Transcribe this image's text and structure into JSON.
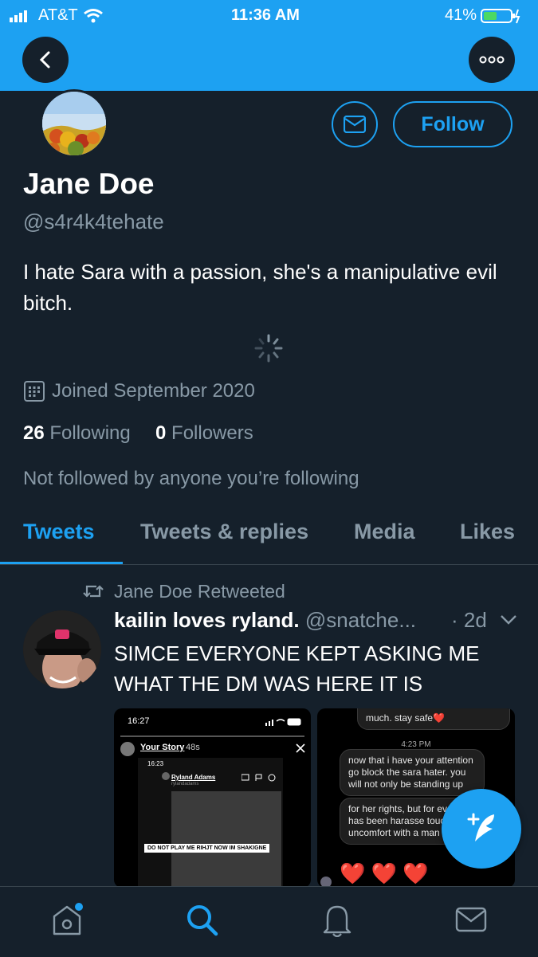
{
  "status_bar": {
    "carrier": "AT&T",
    "time": "11:36 AM",
    "battery": "41%"
  },
  "header": {
    "back_icon": "chevron-left-icon",
    "more_icon": "ellipsis-icon"
  },
  "profile": {
    "follow_label": "Follow",
    "name": "Jane Doe",
    "handle": "@s4r4k4tehate",
    "bio": "I hate Sara with a passion, she's a manipulative evil bitch.",
    "joined": "Joined September 2020",
    "following_count": "26",
    "following_label": "Following",
    "followers_count": "0",
    "followers_label": "Followers",
    "not_followed_text": "Not followed by anyone you’re following"
  },
  "tabs": [
    {
      "label": "Tweets",
      "active": true
    },
    {
      "label": "Tweets & replies"
    },
    {
      "label": "Media"
    },
    {
      "label": "Likes"
    }
  ],
  "tweet": {
    "retweet_label": "Jane Doe Retweeted",
    "author_name": "kailin loves ryland.",
    "author_handle": "@snatche...",
    "time": "· 2d",
    "text": "SIMCE EVERYONE KEPT ASKING ME WHAT THE DM WAS HERE IT IS",
    "media_left": {
      "time": "16:27",
      "story_label": "Your Story",
      "story_age": "48s",
      "inner_time": "16:23",
      "inner_name": "Ryland Adams",
      "inner_sub": "rylandadams",
      "caption": "DO NOT PLAY ME RIHJT NOW IM SHAKIGNE"
    },
    "media_right": {
      "top_msg": "much. stay safe❤️",
      "timestamp": "4:23 PM",
      "msg1": "now that i have your attention go block the sara hater. you will not only be standing up",
      "msg2": "for her rights, but for ev who has been harasse touched, or uncomfort with a man",
      "hearts": "❤️ ❤️ ❤️"
    }
  },
  "colors": {
    "accent": "#1da1f2",
    "background": "#15202b",
    "muted": "#8899a6",
    "border": "#38444d"
  },
  "bottom_nav": [
    "home-icon",
    "search-icon",
    "notifications-icon",
    "messages-icon"
  ],
  "fab_icon": "compose-tweet-icon"
}
